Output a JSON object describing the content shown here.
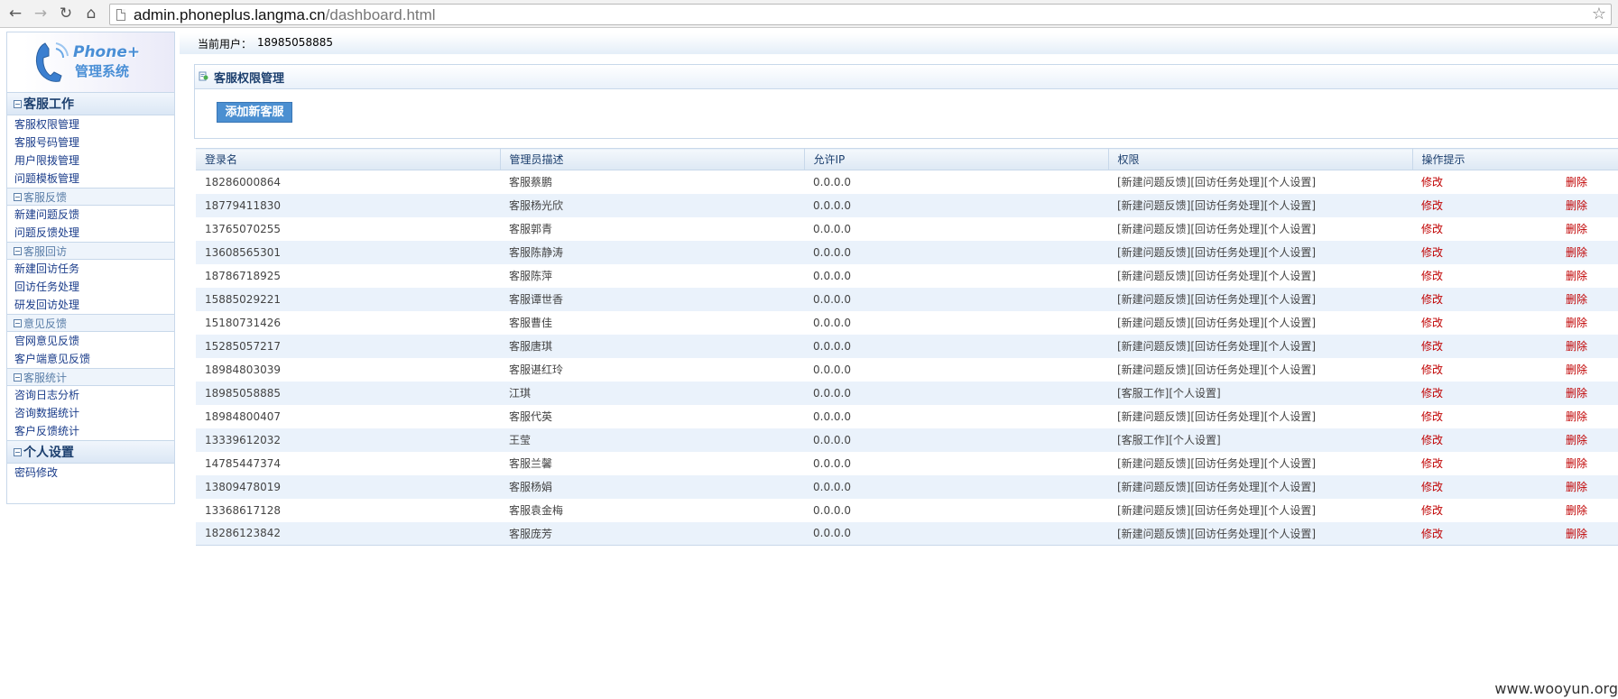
{
  "browser": {
    "url_host": "admin.phoneplus.langma.cn",
    "url_path": "/dashboard.html"
  },
  "logo": {
    "title": "Phone+",
    "subtitle": "管理系统"
  },
  "sidebar": {
    "groups": [
      {
        "title": "客服工作",
        "style": "main",
        "items": [
          "客服权限管理",
          "客服号码管理",
          "用户限拨管理",
          "问题模板管理"
        ]
      },
      {
        "title": "客服反馈",
        "style": "sub",
        "items": [
          "新建问题反馈",
          "问题反馈处理"
        ]
      },
      {
        "title": "客服回访",
        "style": "sub",
        "items": [
          "新建回访任务",
          "回访任务处理",
          "研发回访处理"
        ]
      },
      {
        "title": "意见反馈",
        "style": "sub",
        "items": [
          "官网意见反馈",
          "客户端意见反馈"
        ]
      },
      {
        "title": "客服统计",
        "style": "sub",
        "items": [
          "咨询日志分析",
          "咨询数据统计",
          "客户反馈统计"
        ]
      },
      {
        "title": "个人设置",
        "style": "main",
        "items": [
          "密码修改"
        ]
      }
    ]
  },
  "userbar": {
    "label": "当前用户：",
    "user": "18985058885"
  },
  "panel": {
    "title": "客服权限管理",
    "add_button": "添加新客服"
  },
  "table": {
    "headers": [
      "登录名",
      "管理员描述",
      "允许IP",
      "权限",
      "操作提示"
    ],
    "edit_label": "修改",
    "delete_label": "删除",
    "rows": [
      {
        "login": "18286000864",
        "desc": "客服蔡鹏",
        "ip": "0.0.0.0",
        "perm": "[新建问题反馈][回访任务处理][个人设置]"
      },
      {
        "login": "18779411830",
        "desc": "客服杨光欣",
        "ip": "0.0.0.0",
        "perm": "[新建问题反馈][回访任务处理][个人设置]"
      },
      {
        "login": "13765070255",
        "desc": "客服郭青",
        "ip": "0.0.0.0",
        "perm": "[新建问题反馈][回访任务处理][个人设置]"
      },
      {
        "login": "13608565301",
        "desc": "客服陈静涛",
        "ip": "0.0.0.0",
        "perm": "[新建问题反馈][回访任务处理][个人设置]"
      },
      {
        "login": "18786718925",
        "desc": "客服陈萍",
        "ip": "0.0.0.0",
        "perm": "[新建问题反馈][回访任务处理][个人设置]"
      },
      {
        "login": "15885029221",
        "desc": "客服谭世香",
        "ip": "0.0.0.0",
        "perm": "[新建问题反馈][回访任务处理][个人设置]"
      },
      {
        "login": "15180731426",
        "desc": "客服曹佳",
        "ip": "0.0.0.0",
        "perm": "[新建问题反馈][回访任务处理][个人设置]"
      },
      {
        "login": "15285057217",
        "desc": "客服唐琪",
        "ip": "0.0.0.0",
        "perm": "[新建问题反馈][回访任务处理][个人设置]"
      },
      {
        "login": "18984803039",
        "desc": "客服谌红玲",
        "ip": "0.0.0.0",
        "perm": "[新建问题反馈][回访任务处理][个人设置]"
      },
      {
        "login": "18985058885",
        "desc": "江琪",
        "ip": "0.0.0.0",
        "perm": "[客服工作][个人设置]"
      },
      {
        "login": "18984800407",
        "desc": "客服代英",
        "ip": "0.0.0.0",
        "perm": "[新建问题反馈][回访任务处理][个人设置]"
      },
      {
        "login": "13339612032",
        "desc": "王莹",
        "ip": "0.0.0.0",
        "perm": "[客服工作][个人设置]"
      },
      {
        "login": "14785447374",
        "desc": "客服兰馨",
        "ip": "0.0.0.0",
        "perm": "[新建问题反馈][回访任务处理][个人设置]"
      },
      {
        "login": "13809478019",
        "desc": "客服杨娟",
        "ip": "0.0.0.0",
        "perm": "[新建问题反馈][回访任务处理][个人设置]"
      },
      {
        "login": "13368617128",
        "desc": "客服袁金梅",
        "ip": "0.0.0.0",
        "perm": "[新建问题反馈][回访任务处理][个人设置]"
      },
      {
        "login": "18286123842",
        "desc": "客服庞芳",
        "ip": "0.0.0.0",
        "perm": "[新建问题反馈][回访任务处理][个人设置]"
      }
    ]
  },
  "watermark": "www.wooyun.org",
  "colors": {
    "accent": "#4b8fd1",
    "action": "#c00000",
    "row_alt": "#eaf2fb"
  }
}
